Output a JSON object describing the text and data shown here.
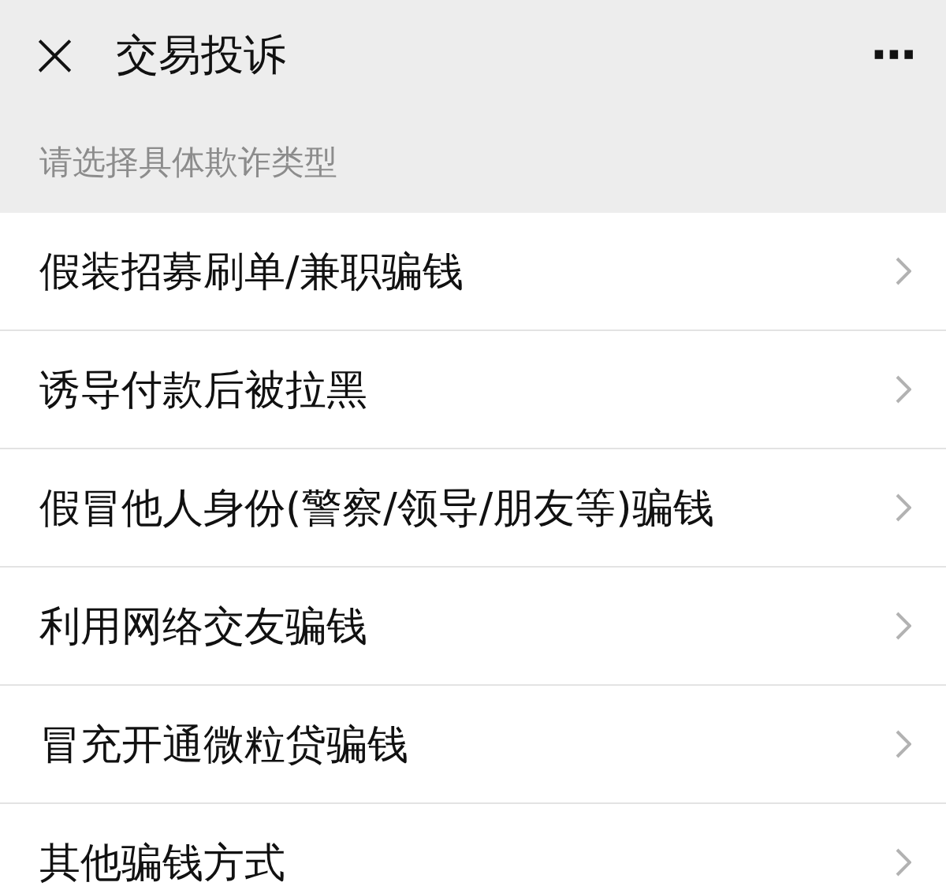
{
  "header": {
    "close": "×",
    "title": "交易投诉",
    "more": "···"
  },
  "section_label": "请选择具体欺诈类型",
  "items": [
    {
      "label": "假装招募刷单/兼职骗钱"
    },
    {
      "label": "诱导付款后被拉黑"
    },
    {
      "label": "假冒他人身份(警察/领导/朋友等)骗钱"
    },
    {
      "label": "利用网络交友骗钱"
    },
    {
      "label": "冒充开通微粒贷骗钱"
    },
    {
      "label": "其他骗钱方式"
    }
  ]
}
